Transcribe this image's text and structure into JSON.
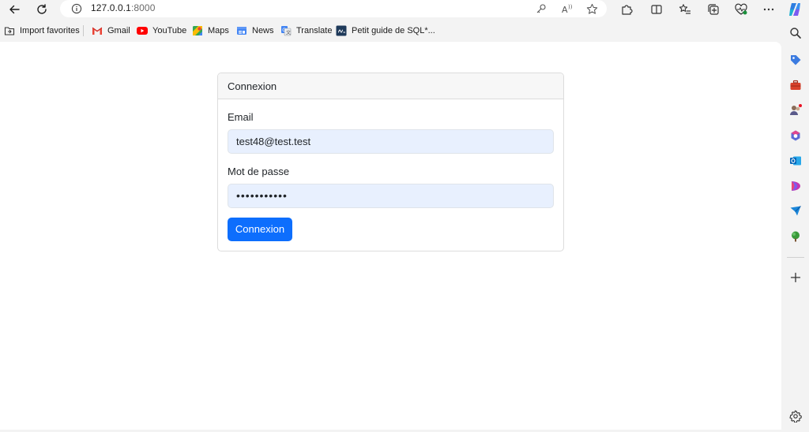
{
  "browser": {
    "url_host": "127.0.0.1",
    "url_port": ":8000"
  },
  "bookmarks": [
    {
      "label": "Import favorites",
      "icon": "folder-import-icon"
    },
    {
      "label": "Gmail",
      "icon": "gmail-icon"
    },
    {
      "label": "YouTube",
      "icon": "youtube-icon"
    },
    {
      "label": "Maps",
      "icon": "maps-icon"
    },
    {
      "label": "News",
      "icon": "news-icon"
    },
    {
      "label": "Translate",
      "icon": "translate-icon"
    },
    {
      "label": "Petit guide de SQL*...",
      "icon": "sql-guide-icon"
    }
  ],
  "card": {
    "header": "Connexion",
    "email_label": "Email",
    "email_value": "test48@test.test",
    "password_label": "Mot de passe",
    "password_value": "•••••••••••",
    "submit_label": "Connexion"
  },
  "colors": {
    "primary": "#0d6efd",
    "autofill": "#e8f0fe",
    "chrome": "#f3f3f3"
  }
}
